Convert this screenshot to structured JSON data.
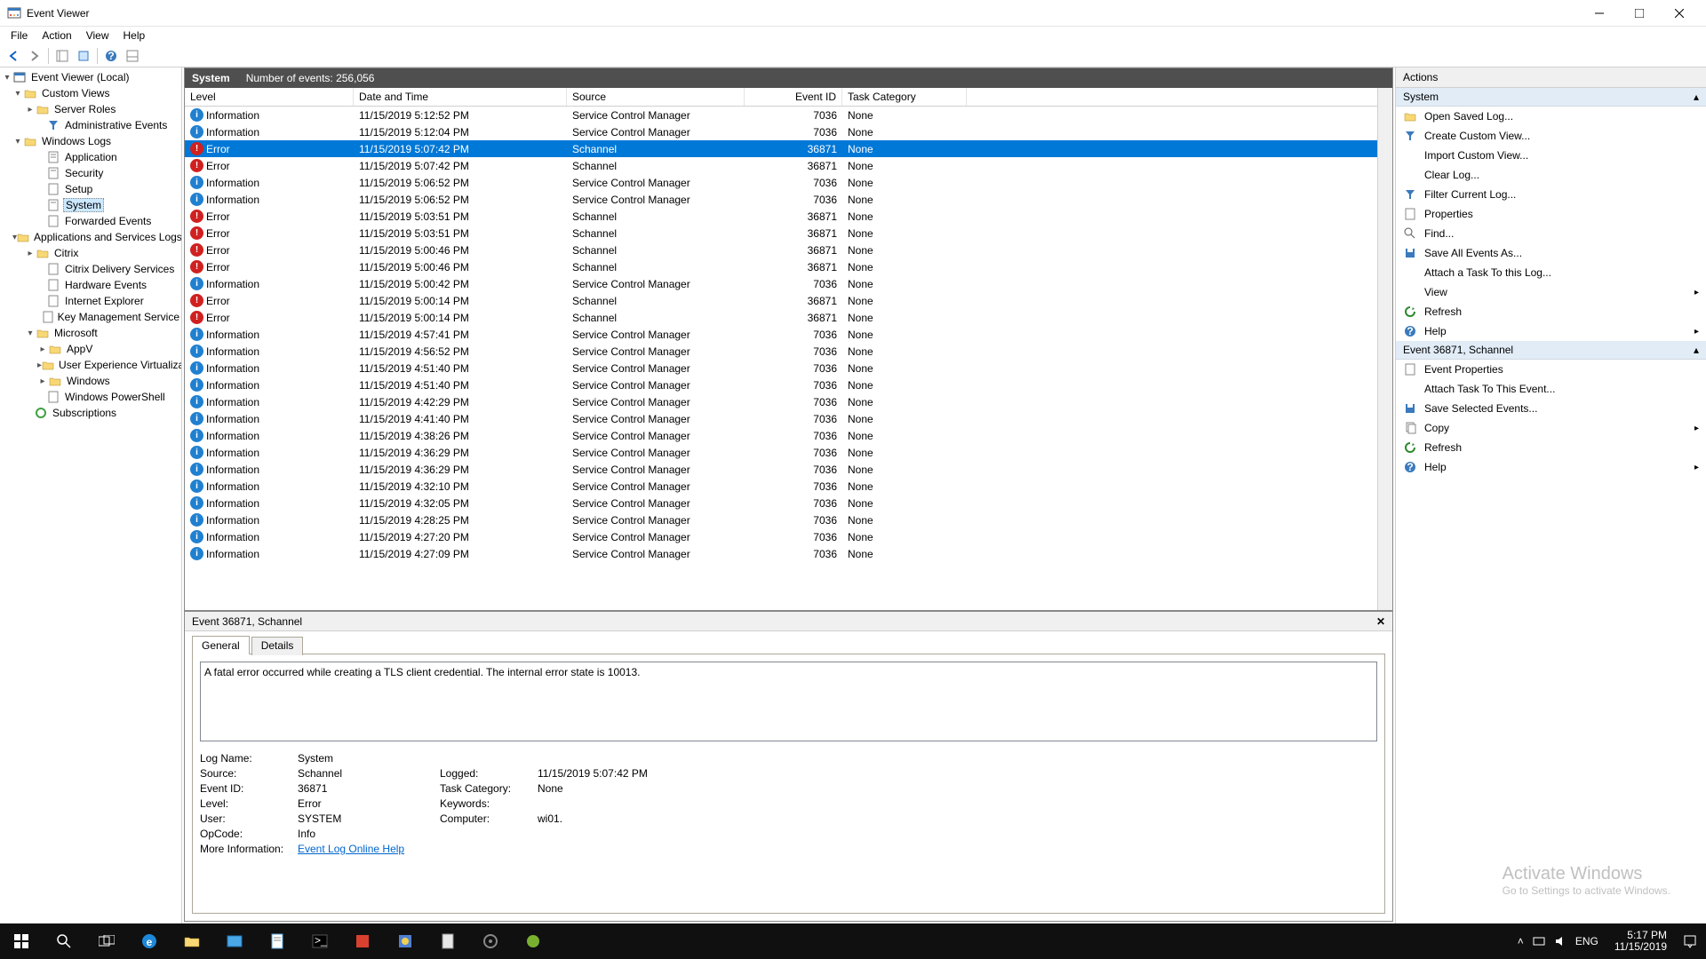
{
  "window": {
    "title": "Event Viewer"
  },
  "menubar": [
    "File",
    "Action",
    "View",
    "Help"
  ],
  "nav": {
    "root": "Event Viewer (Local)",
    "custom_views": "Custom Views",
    "server_roles": "Server Roles",
    "admin_events": "Administrative Events",
    "windows_logs": "Windows Logs",
    "application": "Application",
    "security": "Security",
    "setup": "Setup",
    "system": "System",
    "forwarded": "Forwarded Events",
    "apps_services": "Applications and Services Logs",
    "citrix": "Citrix",
    "citrix_delivery": "Citrix Delivery Services",
    "hardware_events": "Hardware Events",
    "ie": "Internet Explorer",
    "kms": "Key Management Service",
    "microsoft": "Microsoft",
    "appv": "AppV",
    "uev": "User Experience Virtualization",
    "windows": "Windows",
    "wps": "Windows PowerShell",
    "subscriptions": "Subscriptions"
  },
  "center": {
    "title": "System",
    "count_label": "Number of events: 256,056",
    "columns": [
      "Level",
      "Date and Time",
      "Source",
      "Event ID",
      "Task Category"
    ],
    "rows": [
      {
        "level": "Information",
        "date": "11/15/2019 5:12:52 PM",
        "source": "Service Control Manager",
        "eid": "7036",
        "task": "None"
      },
      {
        "level": "Information",
        "date": "11/15/2019 5:12:04 PM",
        "source": "Service Control Manager",
        "eid": "7036",
        "task": "None"
      },
      {
        "level": "Error",
        "date": "11/15/2019 5:07:42 PM",
        "source": "Schannel",
        "eid": "36871",
        "task": "None",
        "selected": true
      },
      {
        "level": "Error",
        "date": "11/15/2019 5:07:42 PM",
        "source": "Schannel",
        "eid": "36871",
        "task": "None"
      },
      {
        "level": "Information",
        "date": "11/15/2019 5:06:52 PM",
        "source": "Service Control Manager",
        "eid": "7036",
        "task": "None"
      },
      {
        "level": "Information",
        "date": "11/15/2019 5:06:52 PM",
        "source": "Service Control Manager",
        "eid": "7036",
        "task": "None"
      },
      {
        "level": "Error",
        "date": "11/15/2019 5:03:51 PM",
        "source": "Schannel",
        "eid": "36871",
        "task": "None"
      },
      {
        "level": "Error",
        "date": "11/15/2019 5:03:51 PM",
        "source": "Schannel",
        "eid": "36871",
        "task": "None"
      },
      {
        "level": "Error",
        "date": "11/15/2019 5:00:46 PM",
        "source": "Schannel",
        "eid": "36871",
        "task": "None"
      },
      {
        "level": "Error",
        "date": "11/15/2019 5:00:46 PM",
        "source": "Schannel",
        "eid": "36871",
        "task": "None"
      },
      {
        "level": "Information",
        "date": "11/15/2019 5:00:42 PM",
        "source": "Service Control Manager",
        "eid": "7036",
        "task": "None"
      },
      {
        "level": "Error",
        "date": "11/15/2019 5:00:14 PM",
        "source": "Schannel",
        "eid": "36871",
        "task": "None"
      },
      {
        "level": "Error",
        "date": "11/15/2019 5:00:14 PM",
        "source": "Schannel",
        "eid": "36871",
        "task": "None"
      },
      {
        "level": "Information",
        "date": "11/15/2019 4:57:41 PM",
        "source": "Service Control Manager",
        "eid": "7036",
        "task": "None"
      },
      {
        "level": "Information",
        "date": "11/15/2019 4:56:52 PM",
        "source": "Service Control Manager",
        "eid": "7036",
        "task": "None"
      },
      {
        "level": "Information",
        "date": "11/15/2019 4:51:40 PM",
        "source": "Service Control Manager",
        "eid": "7036",
        "task": "None"
      },
      {
        "level": "Information",
        "date": "11/15/2019 4:51:40 PM",
        "source": "Service Control Manager",
        "eid": "7036",
        "task": "None"
      },
      {
        "level": "Information",
        "date": "11/15/2019 4:42:29 PM",
        "source": "Service Control Manager",
        "eid": "7036",
        "task": "None"
      },
      {
        "level": "Information",
        "date": "11/15/2019 4:41:40 PM",
        "source": "Service Control Manager",
        "eid": "7036",
        "task": "None"
      },
      {
        "level": "Information",
        "date": "11/15/2019 4:38:26 PM",
        "source": "Service Control Manager",
        "eid": "7036",
        "task": "None"
      },
      {
        "level": "Information",
        "date": "11/15/2019 4:36:29 PM",
        "source": "Service Control Manager",
        "eid": "7036",
        "task": "None"
      },
      {
        "level": "Information",
        "date": "11/15/2019 4:36:29 PM",
        "source": "Service Control Manager",
        "eid": "7036",
        "task": "None"
      },
      {
        "level": "Information",
        "date": "11/15/2019 4:32:10 PM",
        "source": "Service Control Manager",
        "eid": "7036",
        "task": "None"
      },
      {
        "level": "Information",
        "date": "11/15/2019 4:32:05 PM",
        "source": "Service Control Manager",
        "eid": "7036",
        "task": "None"
      },
      {
        "level": "Information",
        "date": "11/15/2019 4:28:25 PM",
        "source": "Service Control Manager",
        "eid": "7036",
        "task": "None"
      },
      {
        "level": "Information",
        "date": "11/15/2019 4:27:20 PM",
        "source": "Service Control Manager",
        "eid": "7036",
        "task": "None"
      },
      {
        "level": "Information",
        "date": "11/15/2019 4:27:09 PM",
        "source": "Service Control Manager",
        "eid": "7036",
        "task": "None"
      }
    ]
  },
  "detail": {
    "header": "Event 36871, Schannel",
    "tabs": {
      "general": "General",
      "details": "Details"
    },
    "description": "A fatal error occurred while creating a TLS client credential. The internal error state is 10013.",
    "labels": {
      "log_name": "Log Name:",
      "source": "Source:",
      "logged": "Logged:",
      "event_id": "Event ID:",
      "task_cat": "Task Category:",
      "level": "Level:",
      "keywords": "Keywords:",
      "user": "User:",
      "computer": "Computer:",
      "opcode": "OpCode:",
      "more_info": "More Information:"
    },
    "values": {
      "log_name": "System",
      "source": "Schannel",
      "logged": "11/15/2019 5:07:42 PM",
      "event_id": "36871",
      "task_cat": "None",
      "level": "Error",
      "keywords": "",
      "user": "SYSTEM",
      "computer": "wi01.",
      "opcode": "Info",
      "more_info": "Event Log Online Help"
    }
  },
  "actions": {
    "header": "Actions",
    "section1": "System",
    "items1": [
      "Open Saved Log...",
      "Create Custom View...",
      "Import Custom View...",
      "Clear Log...",
      "Filter Current Log...",
      "Properties",
      "Find...",
      "Save All Events As...",
      "Attach a Task To this Log..."
    ],
    "view": "View",
    "refresh1": "Refresh",
    "help1": "Help",
    "section2": "Event 36871, Schannel",
    "items2": [
      "Event Properties",
      "Attach Task To This Event...",
      "Save Selected Events..."
    ],
    "copy": "Copy",
    "refresh2": "Refresh",
    "help2": "Help"
  },
  "watermark": {
    "l1": "Activate Windows",
    "l2": "Go to Settings to activate Windows."
  },
  "taskbar": {
    "lang": "ENG",
    "time": "5:17 PM",
    "date": "11/15/2019"
  }
}
